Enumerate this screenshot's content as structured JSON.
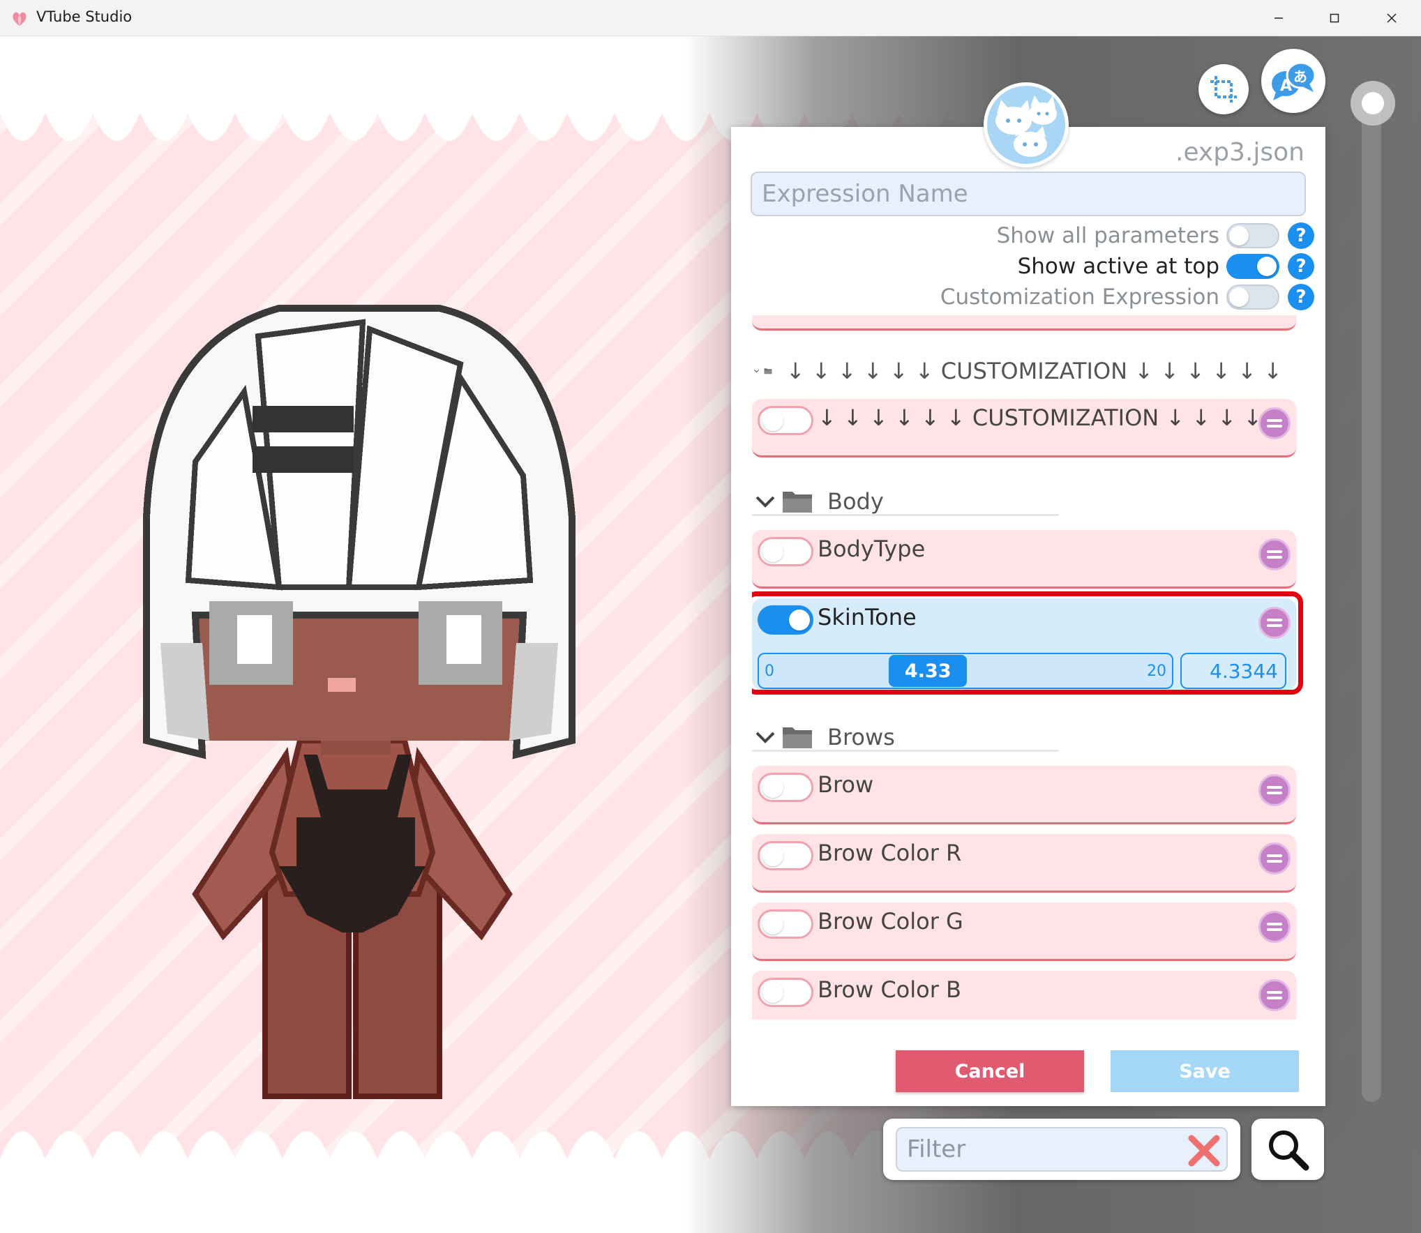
{
  "window": {
    "title": "VTube Studio",
    "accent": "#1b8ff0",
    "card_pink": "#ffe3e6",
    "card_blue": "#d7ecfb"
  },
  "panel": {
    "file_extension": ".exp3.json",
    "expression_name_placeholder": "Expression Name",
    "expression_name_value": "",
    "options": [
      {
        "label": "Show all parameters",
        "on": false
      },
      {
        "label": "Show active at top",
        "on": true
      },
      {
        "label": "Customization Expression",
        "on": false
      }
    ],
    "groups": [
      {
        "title": "↓ ↓ ↓ ↓ ↓ ↓ CUSTOMIZATION ↓ ↓ ↓ ↓ ↓ ↓",
        "params": [
          {
            "name": "↓ ↓ ↓ ↓ ↓ ↓ CUSTOMIZATION ↓ ↓ ↓ ↓ ···",
            "on": false
          }
        ]
      },
      {
        "title": "Body",
        "params": [
          {
            "name": "BodyType",
            "on": false
          },
          {
            "name": "SkinTone",
            "on": true
          }
        ]
      },
      {
        "title": "Brows",
        "params": [
          {
            "name": "Brow",
            "on": false
          },
          {
            "name": "Brow Color R",
            "on": false
          },
          {
            "name": "Brow Color G",
            "on": false
          },
          {
            "name": "Brow Color B",
            "on": false
          }
        ]
      }
    ],
    "skintone_slider": {
      "min": "0",
      "max": "20",
      "value": 4.33,
      "value_label": "4.33",
      "exact_value": "4.3344"
    },
    "cancel_label": "Cancel",
    "save_label": "Save"
  },
  "filter": {
    "placeholder": "Filter",
    "value": ""
  },
  "icons": {
    "crop": "crop-icon",
    "language": "translate-icon",
    "help": "?",
    "search": "magnifier-icon",
    "clear": "x-icon"
  }
}
